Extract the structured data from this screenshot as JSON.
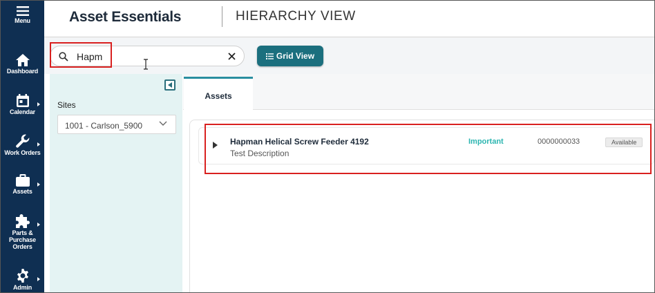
{
  "sidebar": {
    "menu_label": "Menu",
    "items": [
      {
        "label": "Dashboard",
        "icon": "home-icon"
      },
      {
        "label": "Calendar",
        "icon": "calendar-icon"
      },
      {
        "label": "Work Orders",
        "icon": "wrench-icon"
      },
      {
        "label": "Assets",
        "icon": "briefcase-icon"
      },
      {
        "label": "Parts & Purchase Orders",
        "label_lines": [
          "Parts &",
          "Purchase",
          "Orders"
        ],
        "icon": "puzzle-icon"
      },
      {
        "label": "Admin",
        "icon": "gear-icon"
      }
    ]
  },
  "header": {
    "app_title": "Asset Essentials",
    "view_title": "HIERARCHY VIEW"
  },
  "toolbar": {
    "search_value": "Hapm",
    "grid_view_label": "Grid View"
  },
  "left_panel": {
    "sites_label": "Sites",
    "site_selected": "1001 - Carlson_5900"
  },
  "tabs": [
    {
      "label": "Assets",
      "active": true
    }
  ],
  "assets": [
    {
      "name": "Hapman Helical Screw Feeder 4192",
      "description": "Test Description",
      "priority": "Important",
      "number": "0000000033",
      "status": "Available"
    }
  ],
  "colors": {
    "sidebar_bg": "#0f2f52",
    "accent_teal": "#1b6f7e",
    "priority_teal": "#2bb5b0",
    "highlight_red": "#d9201f"
  }
}
